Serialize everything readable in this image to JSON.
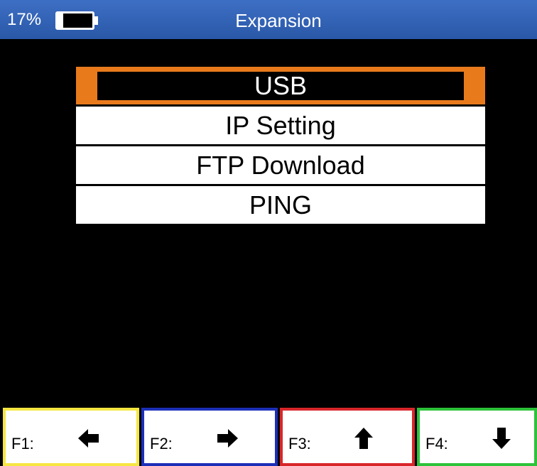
{
  "header": {
    "battery_percent": "17%",
    "battery_level": 0.17,
    "title": "Expansion"
  },
  "menu": {
    "items": [
      {
        "label": "USB",
        "selected": true
      },
      {
        "label": "IP Setting",
        "selected": false
      },
      {
        "label": "FTP Download",
        "selected": false
      },
      {
        "label": "PING",
        "selected": false
      }
    ]
  },
  "function_keys": [
    {
      "label": "F1:",
      "icon": "arrow-left-icon",
      "border_color": "#f5e642"
    },
    {
      "label": "F2:",
      "icon": "arrow-right-icon",
      "border_color": "#1c2fb8"
    },
    {
      "label": "F3:",
      "icon": "arrow-up-icon",
      "border_color": "#d8262a"
    },
    {
      "label": "F4:",
      "icon": "arrow-down-icon",
      "border_color": "#2cc23a"
    }
  ],
  "colors": {
    "header_bg": "#2f5fb3",
    "selection": "#e87a1c",
    "background": "#000000"
  }
}
